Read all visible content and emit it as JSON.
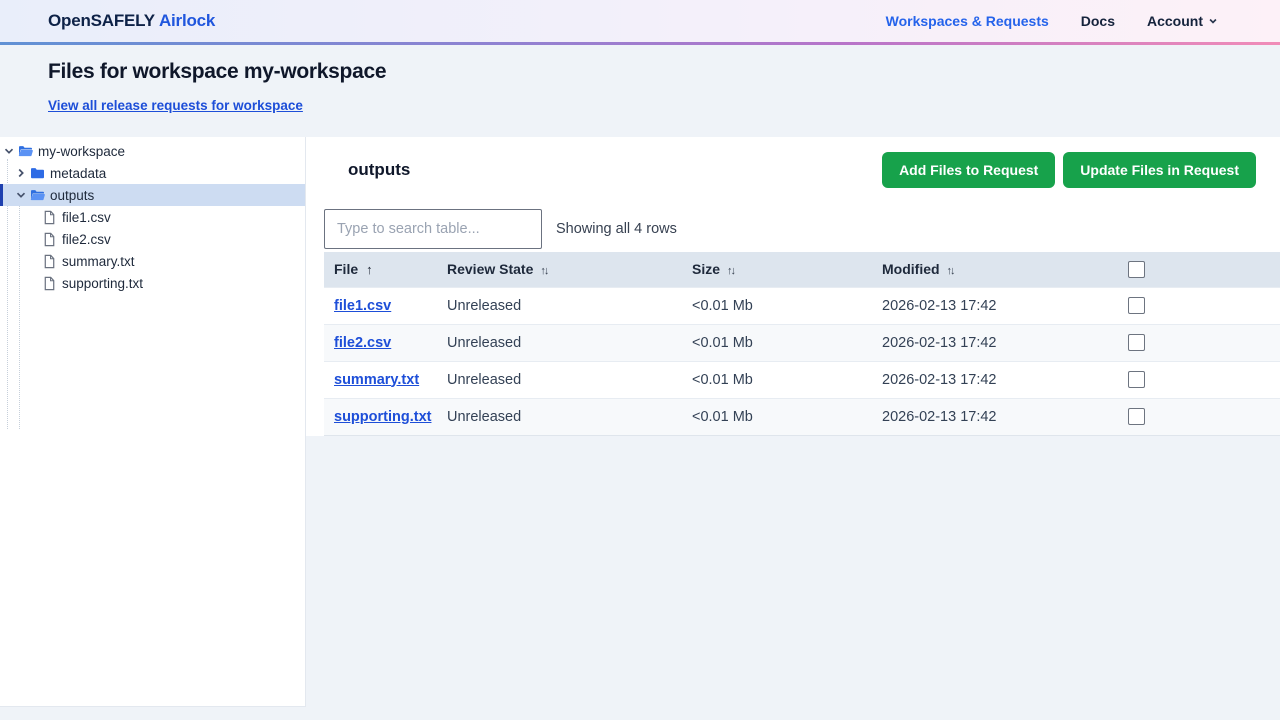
{
  "navbar": {
    "brand_main": "OpenSAFELY",
    "brand_sub": "Airlock",
    "links": {
      "workspaces": "Workspaces & Requests",
      "docs": "Docs",
      "account": "Account"
    }
  },
  "header": {
    "title": "Files for workspace my-workspace",
    "subtitle_link": "View all release requests for workspace"
  },
  "tree": {
    "items": [
      {
        "label": "my-workspace"
      },
      {
        "label": "metadata"
      },
      {
        "label": "outputs"
      },
      {
        "label": "file1.csv"
      },
      {
        "label": "file2.csv"
      },
      {
        "label": "summary.txt"
      },
      {
        "label": "supporting.txt"
      }
    ]
  },
  "main": {
    "heading": "outputs",
    "add_button": "Add Files to Request",
    "update_button": "Update Files in Request",
    "search_placeholder": "Type to search table...",
    "showing_text": "Showing all 4 rows"
  },
  "table": {
    "headers": {
      "file": "File",
      "review_state": "Review State",
      "size": "Size",
      "modified": "Modified"
    },
    "sort_icons": {
      "asc": "↑",
      "both": "↑↓"
    },
    "rows": [
      {
        "file": "file1.csv",
        "review_state": "Unreleased",
        "size": "<0.01 Mb",
        "modified": "2026-02-13 17:42"
      },
      {
        "file": "file2.csv",
        "review_state": "Unreleased",
        "size": "<0.01 Mb",
        "modified": "2026-02-13 17:42"
      },
      {
        "file": "summary.txt",
        "review_state": "Unreleased",
        "size": "<0.01 Mb",
        "modified": "2026-02-13 17:42"
      },
      {
        "file": "supporting.txt",
        "review_state": "Unreleased",
        "size": "<0.01 Mb",
        "modified": "2026-02-13 17:42"
      }
    ]
  },
  "colors": {
    "accent_green": "#17a24b",
    "link_blue": "#1d4ed8",
    "selected_tree_bg": "#cddcf2",
    "selected_tree_bar": "#1e40af",
    "table_header_bg": "#dde5ee"
  }
}
